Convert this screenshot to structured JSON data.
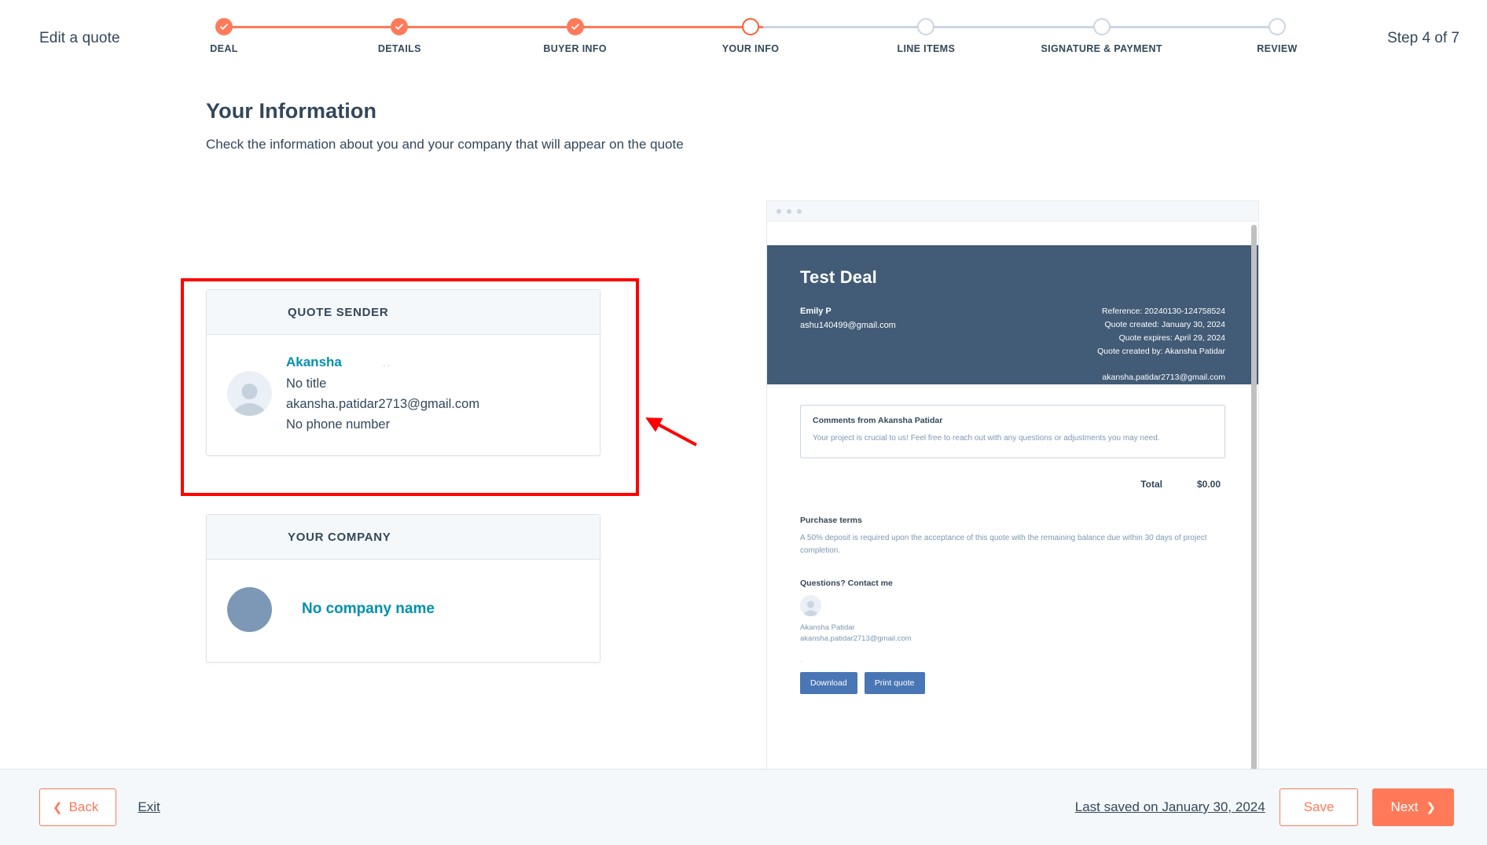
{
  "header": {
    "edit_title": "Edit a quote",
    "step_count": "Step 4 of 7",
    "steps": [
      {
        "label": "DEAL",
        "state": "done"
      },
      {
        "label": "DETAILS",
        "state": "done"
      },
      {
        "label": "BUYER INFO",
        "state": "done"
      },
      {
        "label": "YOUR INFO",
        "state": "current"
      },
      {
        "label": "LINE ITEMS",
        "state": "todo"
      },
      {
        "label": "SIGNATURE & PAYMENT",
        "state": "todo"
      },
      {
        "label": "REVIEW",
        "state": "todo"
      }
    ]
  },
  "main": {
    "title": "Your Information",
    "subtitle": "Check the information about you and your company that will appear on the quote",
    "sender_card": {
      "heading": "QUOTE SENDER",
      "name": "Akansha",
      "name_ghost": "..",
      "title": "No title",
      "email": "akansha.patidar2713@gmail.com",
      "phone": "No phone number"
    },
    "company_card": {
      "heading": "YOUR COMPANY",
      "name": "No company name"
    }
  },
  "preview": {
    "hero": {
      "deal_title": "Test Deal",
      "buyer_name": "Emily P",
      "buyer_email": "ashu140499@gmail.com",
      "reference": "Reference: 20240130-124758524",
      "created": "Quote created: January 30, 2024",
      "expires": "Quote expires: April 29, 2024",
      "created_by": "Quote created by: Akansha Patidar",
      "sender_email": "akansha.patidar2713@gmail.com"
    },
    "comments": {
      "title": "Comments from Akansha Patidar",
      "text": "Your project is crucial to us! Feel free to reach out with any questions or adjustments you may need."
    },
    "total": {
      "label": "Total",
      "value": "$0.00"
    },
    "terms": {
      "title": "Purchase terms",
      "text": "A 50% deposit is required upon the acceptance of this quote with the remaining balance due within 30 days of project completion."
    },
    "contact": {
      "title": "Questions? Contact me",
      "name": "Akansha Patidar",
      "email": "akansha.patidar2713@gmail.com",
      "signature_mark": "."
    },
    "buttons": {
      "download": "Download",
      "print": "Print quote"
    }
  },
  "footer": {
    "back": "Back",
    "exit": "Exit",
    "last_saved": "Last saved on January 30, 2024",
    "save": "Save",
    "next": "Next"
  },
  "colors": {
    "accent": "#ff7a59",
    "link": "#0091ae",
    "hero_bg": "#425b76",
    "annotation": "#ff0000"
  }
}
